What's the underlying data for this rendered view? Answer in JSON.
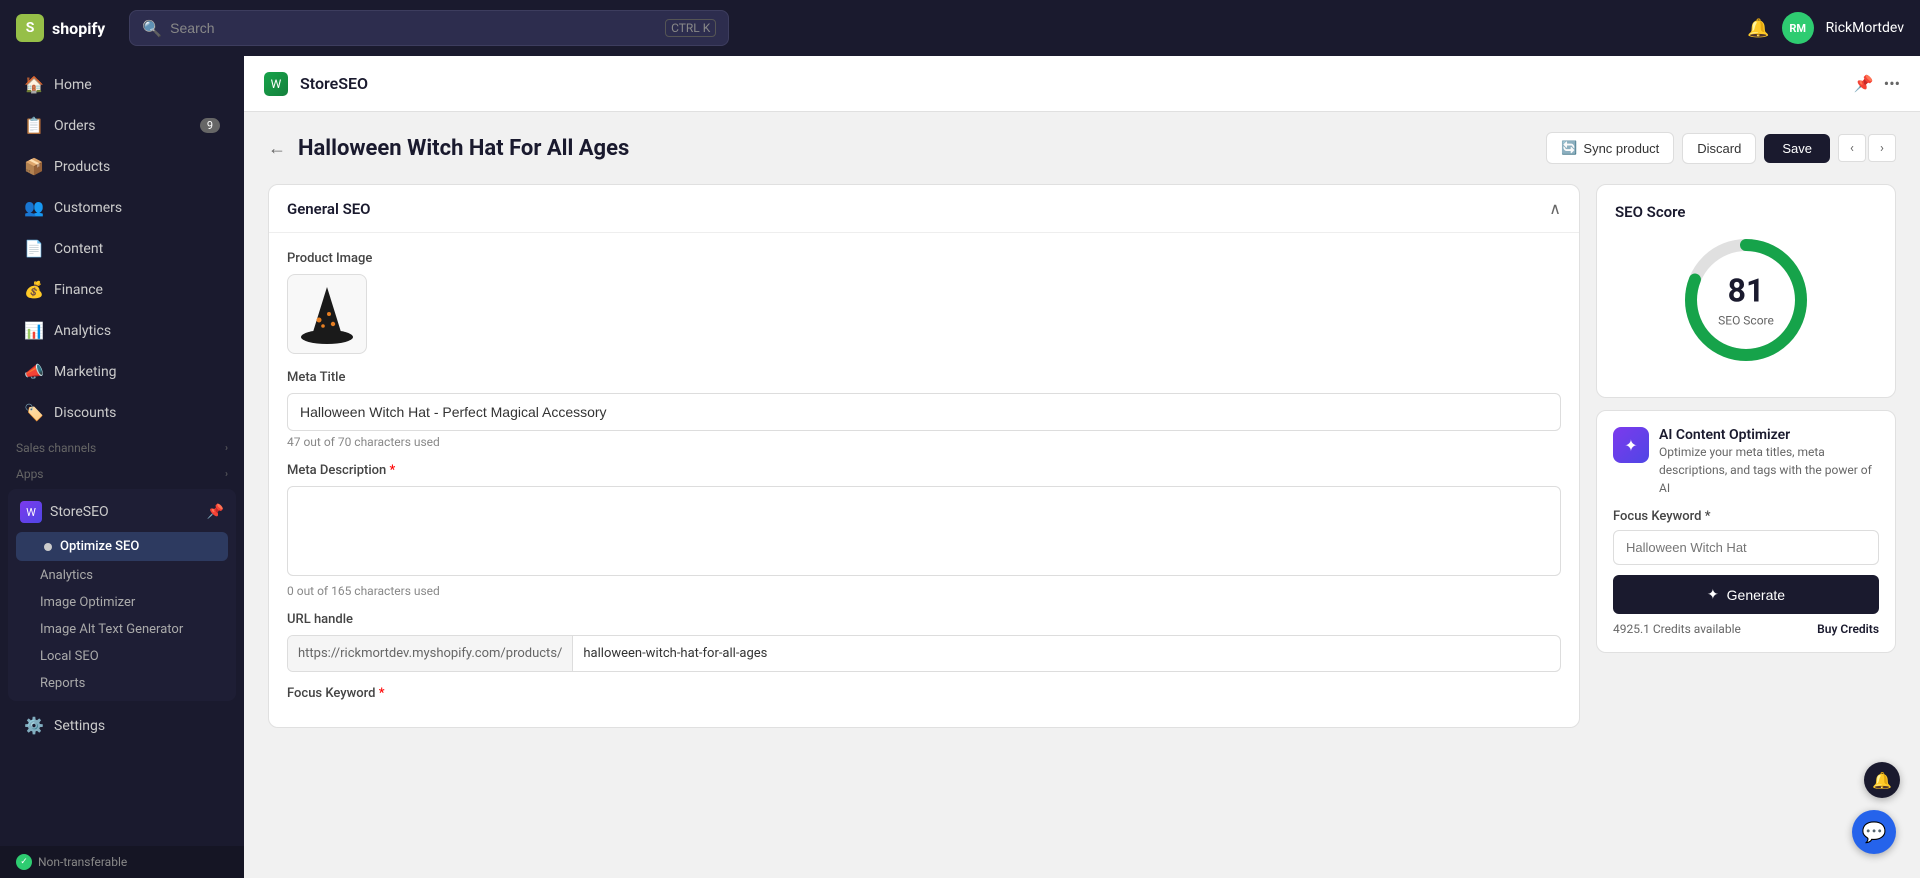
{
  "topbar": {
    "logo_text": "shopify",
    "search_placeholder": "Search",
    "search_shortcut": "CTRL K",
    "username": "RickMortdev"
  },
  "sidebar": {
    "nav_items": [
      {
        "id": "home",
        "label": "Home",
        "icon": "🏠",
        "badge": null
      },
      {
        "id": "orders",
        "label": "Orders",
        "icon": "📋",
        "badge": "9"
      },
      {
        "id": "products",
        "label": "Products",
        "icon": "📦",
        "badge": null
      },
      {
        "id": "customers",
        "label": "Customers",
        "icon": "👥",
        "badge": null
      },
      {
        "id": "content",
        "label": "Content",
        "icon": "📄",
        "badge": null
      },
      {
        "id": "finance",
        "label": "Finance",
        "icon": "💰",
        "badge": null
      },
      {
        "id": "analytics",
        "label": "Analytics",
        "icon": "📊",
        "badge": null
      },
      {
        "id": "marketing",
        "label": "Marketing",
        "icon": "📣",
        "badge": null
      },
      {
        "id": "discounts",
        "label": "Discounts",
        "icon": "🏷️",
        "badge": null
      }
    ],
    "sales_channels_label": "Sales channels",
    "apps_label": "Apps",
    "storeseo_name": "StoreSEO",
    "optimize_seo_label": "Optimize SEO",
    "analytics_sub": "Analytics",
    "image_optimizer_sub": "Image Optimizer",
    "image_alt_text_sub": "Image Alt Text Generator",
    "local_seo_sub": "Local SEO",
    "reports_sub": "Reports",
    "settings_label": "Settings",
    "non_transferable": "Non-transferable"
  },
  "app_header": {
    "app_name": "StoreSEO"
  },
  "page": {
    "title": "Halloween Witch Hat For All Ages",
    "sync_product_label": "Sync product",
    "discard_label": "Discard",
    "save_label": "Save"
  },
  "general_seo": {
    "section_title": "General SEO",
    "product_image_label": "Product Image",
    "meta_title_label": "Meta Title",
    "meta_title_value": "Halloween Witch Hat - Perfect Magical Accessory",
    "meta_title_char_count": "47 out of 70 characters used",
    "meta_description_label": "Meta Description",
    "meta_description_required": "*",
    "meta_description_value": "",
    "meta_description_char_count": "0 out of 165 characters used",
    "url_handle_label": "URL handle",
    "url_prefix": "https://rickmortdev.myshopify.com/products/",
    "url_value": "halloween-witch-hat-for-all-ages",
    "focus_keyword_label": "Focus Keyword",
    "focus_keyword_required": "*"
  },
  "seo_score": {
    "title": "SEO Score",
    "score": "81",
    "score_label": "SEO Score",
    "circle_color": "#16a34a",
    "circle_bg": "#e0e0e0"
  },
  "ai_optimizer": {
    "title": "AI Content Optimizer",
    "description": "Optimize your meta titles, meta descriptions, and tags with the power of AI",
    "focus_keyword_label": "Focus Keyword *",
    "focus_keyword_placeholder": "Halloween Witch Hat",
    "generate_label": "Generate",
    "credits_text": "4925.1 Credits available",
    "buy_credits_label": "Buy Credits"
  },
  "bottom_bar": {
    "product_label": "Halloween Witch Hat"
  }
}
